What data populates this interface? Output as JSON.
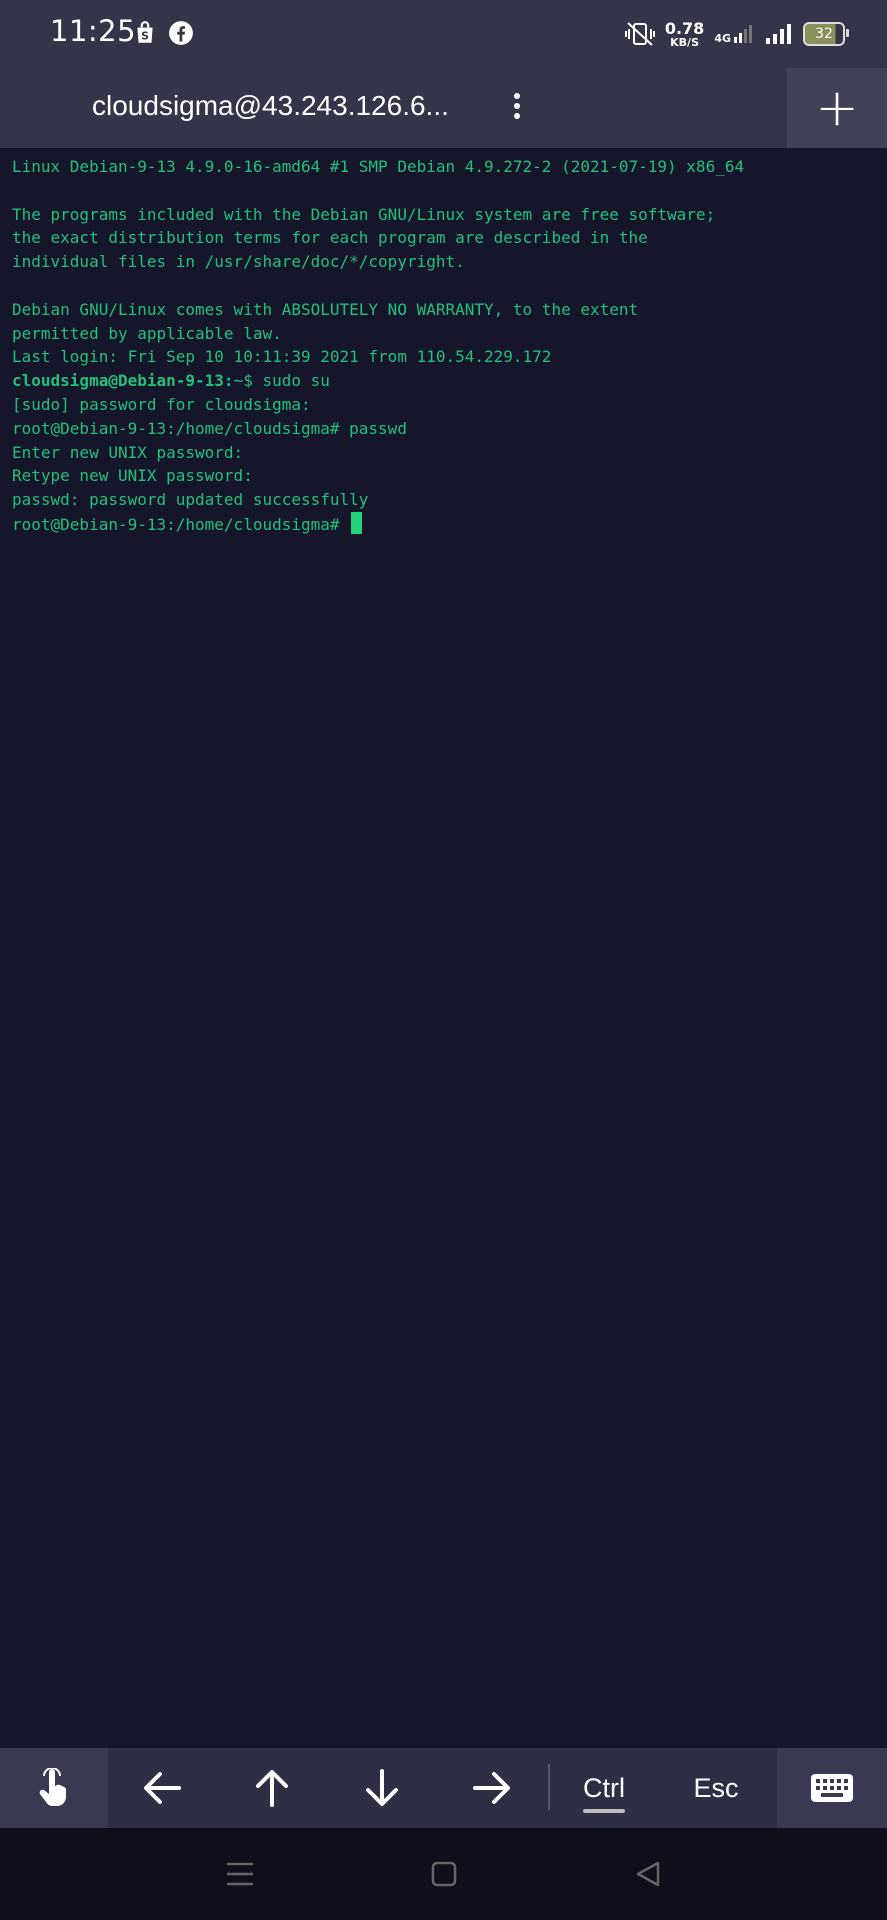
{
  "status_bar": {
    "time": "11:25",
    "notifications": [
      "shopping-bag-icon",
      "facebook-icon"
    ],
    "net_speed_value": "0.78",
    "net_speed_unit": "KB/S",
    "network_type": "4G",
    "battery_level": "32"
  },
  "app_bar": {
    "title": "cloudsigma@43.243.126.6...",
    "add_label": "+"
  },
  "terminal": {
    "lines": [
      "Linux Debian-9-13 4.9.0-16-amd64 #1 SMP Debian 4.9.272-2 (2021-07-19) x86_64",
      "",
      "The programs included with the Debian GNU/Linux system are free software;",
      "the exact distribution terms for each program are described in the",
      "individual files in /usr/share/doc/*/copyright.",
      "",
      "Debian GNU/Linux comes with ABSOLUTELY NO WARRANTY, to the extent",
      "permitted by applicable law.",
      "Last login: Fri Sep 10 10:11:39 2021 from 110.54.229.172"
    ],
    "prompt_user": "cloudsigma@Debian-9-13:",
    "prompt_path": "~$ sudo su",
    "lines_after": [
      "[sudo] password for cloudsigma:",
      "root@Debian-9-13:/home/cloudsigma# passwd",
      "Enter new UNIX password:",
      "Retype new UNIX password:",
      "passwd: password updated successfully"
    ],
    "current_prompt": "root@Debian-9-13:/home/cloudsigma# "
  },
  "keys": {
    "touch": "touch-icon",
    "left": "arrow-left-icon",
    "up": "arrow-up-icon",
    "down": "arrow-down-icon",
    "right": "arrow-right-icon",
    "ctrl_label": "Ctrl",
    "esc_label": "Esc",
    "keyboard": "keyboard-icon"
  },
  "colors": {
    "terminal_text": "#23c07a",
    "terminal_bg": "#16162a",
    "bar_bg": "#343549"
  }
}
